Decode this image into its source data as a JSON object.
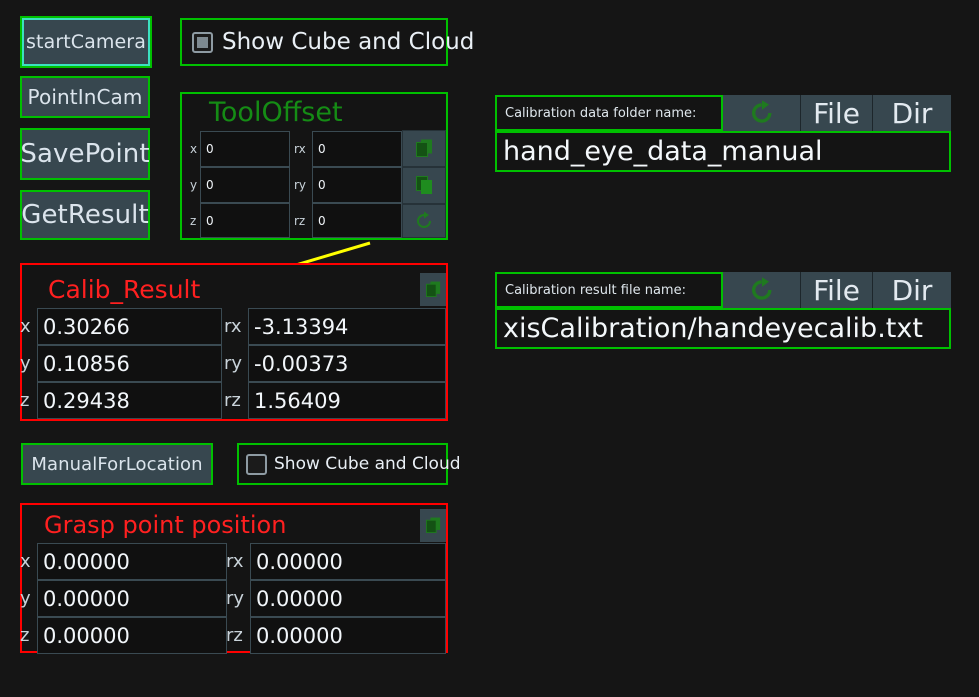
{
  "colors": {
    "background": "#151515",
    "panel_border_green": "#00c000",
    "panel_border_red": "#ff0000",
    "button_face": "#37474f",
    "title_green": "#158c15",
    "title_red": "#ff2020",
    "focus_ring": "#3de0c0",
    "annotation_arrow": "#ffff00",
    "icon_green": "#1f7a1f"
  },
  "left_buttons": [
    {
      "label": "startCamera",
      "focused": true
    },
    {
      "label": "PointInCam",
      "focused": false
    },
    {
      "label": "SavePoint",
      "focused": false
    },
    {
      "label": "GetResult",
      "focused": false
    }
  ],
  "checkbox_top": {
    "label": "Show Cube and Cloud",
    "checked": true
  },
  "checkbox_bottom": {
    "label": "Show Cube and Cloud",
    "checked": false
  },
  "tool_offset": {
    "title": "ToolOffset",
    "rows": [
      {
        "label": "x",
        "value": "0",
        "rlabel": "rx",
        "rvalue": "0",
        "icon": "copy-icon"
      },
      {
        "label": "y",
        "value": "0",
        "rlabel": "ry",
        "rvalue": "0",
        "icon": "paste-icon"
      },
      {
        "label": "z",
        "value": "0",
        "rlabel": "rz",
        "rvalue": "0",
        "icon": "refresh-icon"
      }
    ]
  },
  "calib_result": {
    "title": "Calib_Result",
    "copy_icon": "copy-icon",
    "rows": [
      {
        "label": "x",
        "value": "0.30266",
        "rlabel": "rx",
        "rvalue": "-3.13394"
      },
      {
        "label": "y",
        "value": "0.10856",
        "rlabel": "ry",
        "rvalue": "-0.00373"
      },
      {
        "label": "z",
        "value": "0.29438",
        "rlabel": "rz",
        "rvalue": "1.56409"
      }
    ]
  },
  "manual_button": {
    "label": "ManualForLocation"
  },
  "grasp_point": {
    "title": "Grasp point position",
    "copy_icon": "copy-icon",
    "rows": [
      {
        "label": "x",
        "value": "0.00000",
        "rlabel": "rx",
        "rvalue": "0.00000"
      },
      {
        "label": "y",
        "value": "0.00000",
        "rlabel": "ry",
        "rvalue": "0.00000"
      },
      {
        "label": "z",
        "value": "0.00000",
        "rlabel": "rz",
        "rvalue": "0.00000"
      }
    ]
  },
  "data_folder_panel": {
    "label": "Calibration data folder name:",
    "refresh_icon": "refresh-icon",
    "file_button": "File",
    "dir_button": "Dir",
    "value": "hand_eye_data_manual"
  },
  "result_file_panel": {
    "label": "Calibration result file name:",
    "refresh_icon": "refresh-icon",
    "file_button": "File",
    "dir_button": "Dir",
    "value": "xisCalibration/handeyecalib.txt"
  }
}
